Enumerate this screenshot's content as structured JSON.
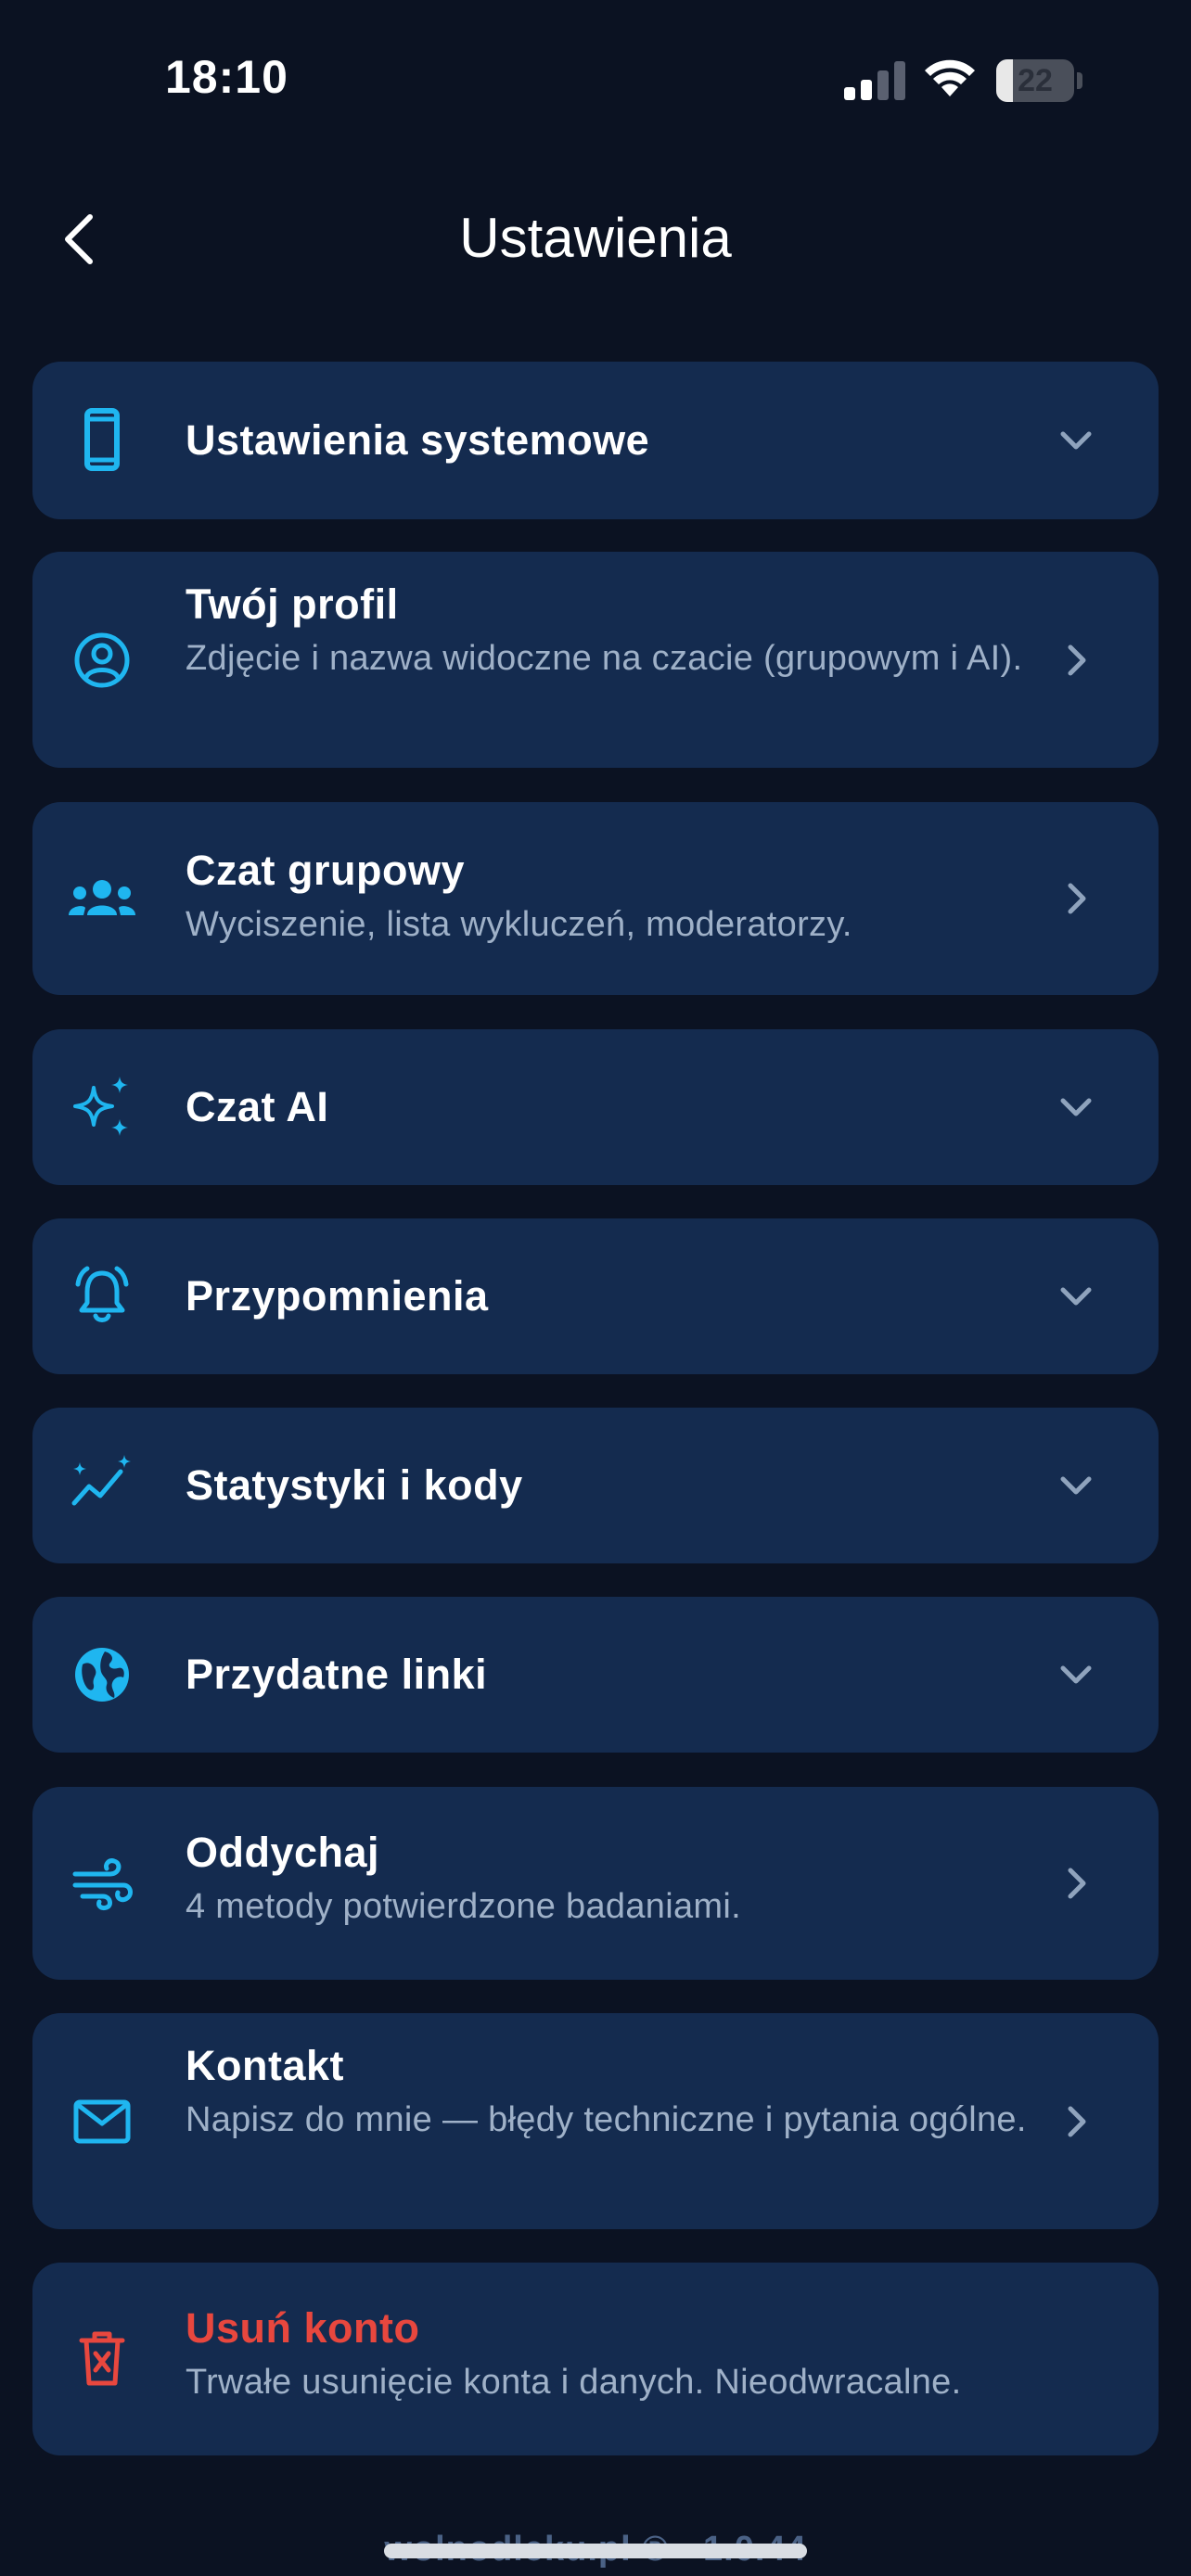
{
  "status_bar": {
    "time": "18:10",
    "battery": "22",
    "battery_level_percent": 22
  },
  "header": {
    "title": "Ustawienia",
    "back_icon": "chevron-left-icon"
  },
  "items": [
    {
      "title": "Ustawienia systemowe",
      "subtitle": "",
      "icon": "phone-icon",
      "action": "expand"
    },
    {
      "title": "Twój profil",
      "subtitle": "Zdjęcie i nazwa widoczne na czacie (grupowym i AI).",
      "icon": "user-circle-icon",
      "action": "navigate"
    },
    {
      "title": "Czat grupowy",
      "subtitle": "Wyciszenie, lista wykluczeń, moderatorzy.",
      "icon": "group-icon",
      "action": "navigate"
    },
    {
      "title": "Czat AI",
      "subtitle": "",
      "icon": "sparkles-icon",
      "action": "expand"
    },
    {
      "title": "Przypomnienia",
      "subtitle": "",
      "icon": "bell-ring-icon",
      "action": "expand"
    },
    {
      "title": "Statystyki i kody",
      "subtitle": "",
      "icon": "trend-chart-icon",
      "action": "expand"
    },
    {
      "title": "Przydatne linki",
      "subtitle": "",
      "icon": "globe-icon",
      "action": "expand"
    },
    {
      "title": "Oddychaj",
      "subtitle": "4 metody potwierdzone badaniami.",
      "icon": "wind-icon",
      "action": "navigate"
    },
    {
      "title": "Kontakt",
      "subtitle": "Napisz do mnie — błędy techniczne i pytania ogólne.",
      "icon": "mail-icon",
      "action": "navigate"
    },
    {
      "title": "Usuń konto",
      "subtitle": "Trwałe usunięcie konta i danych. Nieodwracalne.",
      "icon": "trash-icon",
      "action": "danger"
    }
  ],
  "footer": {
    "text": "wolnodleku.pl ® · 1.0.44"
  },
  "colors": {
    "background": "#0b1222",
    "card": "#142b4f",
    "accent": "#1fb6f0",
    "danger": "#e8473e",
    "subtitle": "#9fb1c8",
    "chevron": "#8fa3bd"
  }
}
